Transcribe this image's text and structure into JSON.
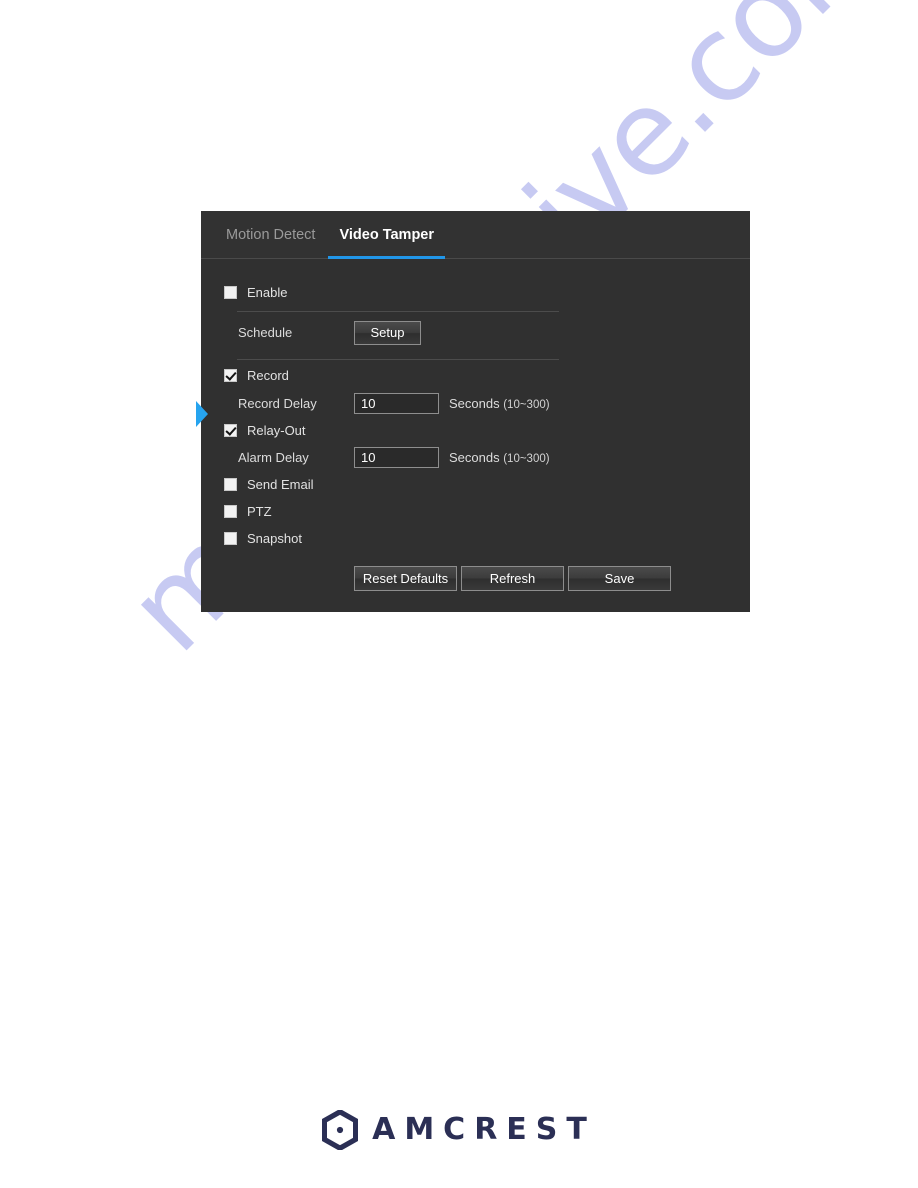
{
  "page": {
    "background_color": "#ffffff"
  },
  "watermark": {
    "text": "manualshive.com",
    "color": "#9aa0e8"
  },
  "panel": {
    "background_color": "#303030",
    "accent_color": "#2196e8",
    "tabs": [
      {
        "label": "Motion Detect",
        "active": false
      },
      {
        "label": "Video Tamper",
        "active": true
      }
    ],
    "marker_icon": "blue-triangle-marker",
    "fields": {
      "enable": {
        "label": "Enable",
        "checked": false
      },
      "schedule": {
        "label": "Schedule",
        "button_label": "Setup"
      },
      "record": {
        "label": "Record",
        "checked": true
      },
      "record_delay": {
        "label": "Record Delay",
        "value": "10",
        "unit": "Seconds",
        "range": "(10~300)"
      },
      "relay_out": {
        "label": "Relay-Out",
        "checked": true
      },
      "alarm_delay": {
        "label": "Alarm Delay",
        "value": "10",
        "unit": "Seconds",
        "range": "(10~300)"
      },
      "send_email": {
        "label": "Send Email",
        "checked": false
      },
      "ptz": {
        "label": "PTZ",
        "checked": false
      },
      "snapshot": {
        "label": "Snapshot",
        "checked": false
      }
    },
    "footer_buttons": [
      {
        "label": "Reset Defaults"
      },
      {
        "label": "Refresh"
      },
      {
        "label": "Save"
      }
    ]
  },
  "logo": {
    "mark_icon": "amcrest-hexagon-camera-icon",
    "wordmark": "AMCREST",
    "color": "#2b2f55"
  }
}
